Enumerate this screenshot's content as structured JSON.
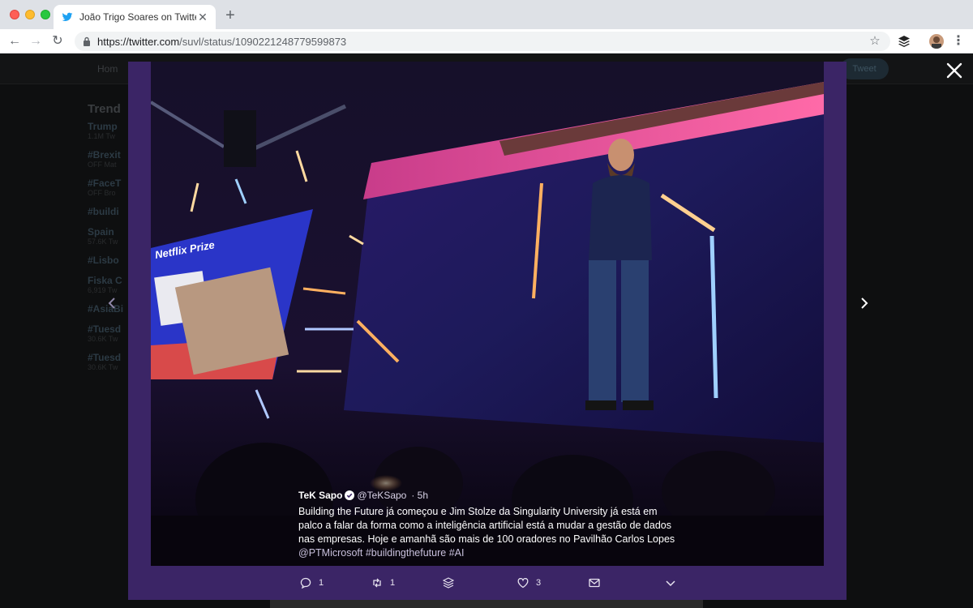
{
  "browser": {
    "tab_title": "João Trigo Soares on Twitter: \"",
    "new_tab": "+",
    "url_host": "https://twitter.com",
    "url_path": "/suvl/status/1090221248779599873"
  },
  "twitter_bg": {
    "home_label": "Hom",
    "tweet_button": "Tweet",
    "trends_title": "Trend",
    "trends": [
      {
        "name": "Trump",
        "meta": "1.1M Tw"
      },
      {
        "name": "#Brexit",
        "meta": "OFF Mat"
      },
      {
        "name": "#FaceT",
        "meta": "OFF Bro"
      },
      {
        "name": "#buildi",
        "meta": ""
      },
      {
        "name": "Spain",
        "meta": "57.6K Tw"
      },
      {
        "name": "#Lisbo",
        "meta": ""
      },
      {
        "name": "Fiska C",
        "meta": "6,919 Tw"
      },
      {
        "name": "#AsiaBi",
        "meta": ""
      },
      {
        "name": "#Tuesd",
        "meta": "30.6K Tw"
      },
      {
        "name": "#Tuesd",
        "meta": "30.6K Tw"
      }
    ]
  },
  "tweet": {
    "author_name": "TeK Sapo",
    "author_handle": "@TeKSapo",
    "time": "· 5h",
    "text": "Building the Future já começou e Jim Stolze da Singularity University já está em palco a falar da forma como a inteligência artificial está a mudar a gestão de dados nas empresas. Hoje e amanhã são mais de 100 oradores no Pavilhão Carlos Lopes",
    "tags": "@PTMicrosoft #buildingthefuture #AI",
    "reply_count": "1",
    "retweet_count": "1",
    "like_count": "3"
  },
  "photo": {
    "slide_title": "Netflix Prize"
  },
  "colors": {
    "panel": "#3b2566",
    "accent_blue": "#1da1f2"
  }
}
